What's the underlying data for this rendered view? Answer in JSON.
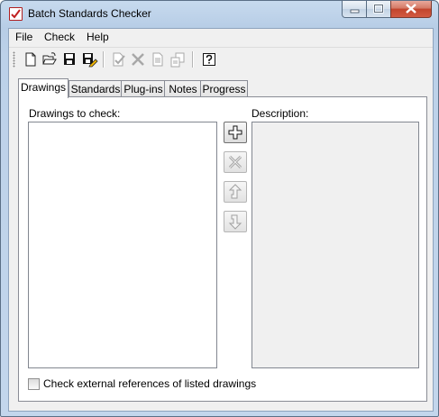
{
  "window": {
    "title": "Batch Standards Checker"
  },
  "menu": [
    {
      "label": "File"
    },
    {
      "label": "Check"
    },
    {
      "label": "Help"
    }
  ],
  "toolbar": {
    "buttons": [
      {
        "name": "new-icon",
        "enabled": true
      },
      {
        "name": "open-icon",
        "enabled": true
      },
      {
        "name": "save-icon",
        "enabled": true
      },
      {
        "name": "save-as-icon",
        "enabled": true
      },
      {
        "name": "check-icon",
        "enabled": false
      },
      {
        "name": "delete-icon",
        "enabled": false
      },
      {
        "name": "copy-icon",
        "enabled": false
      },
      {
        "name": "paste-icon",
        "enabled": false
      },
      {
        "name": "help-icon",
        "enabled": true
      }
    ]
  },
  "tabs": [
    {
      "label": "Drawings",
      "active": true
    },
    {
      "label": "Standards",
      "active": false
    },
    {
      "label": "Plug-ins",
      "active": false
    },
    {
      "label": "Notes",
      "active": false
    },
    {
      "label": "Progress",
      "active": false
    }
  ],
  "drawings": {
    "list_label": "Drawings to check:",
    "description_label": "Description:",
    "items": [],
    "description": "",
    "buttons": [
      {
        "name": "add-icon",
        "enabled": true
      },
      {
        "name": "remove-icon",
        "enabled": false
      },
      {
        "name": "move-up-icon",
        "enabled": false
      },
      {
        "name": "move-down-icon",
        "enabled": false
      }
    ],
    "checkbox_label": "Check external references of listed drawings",
    "checkbox_checked": false
  }
}
